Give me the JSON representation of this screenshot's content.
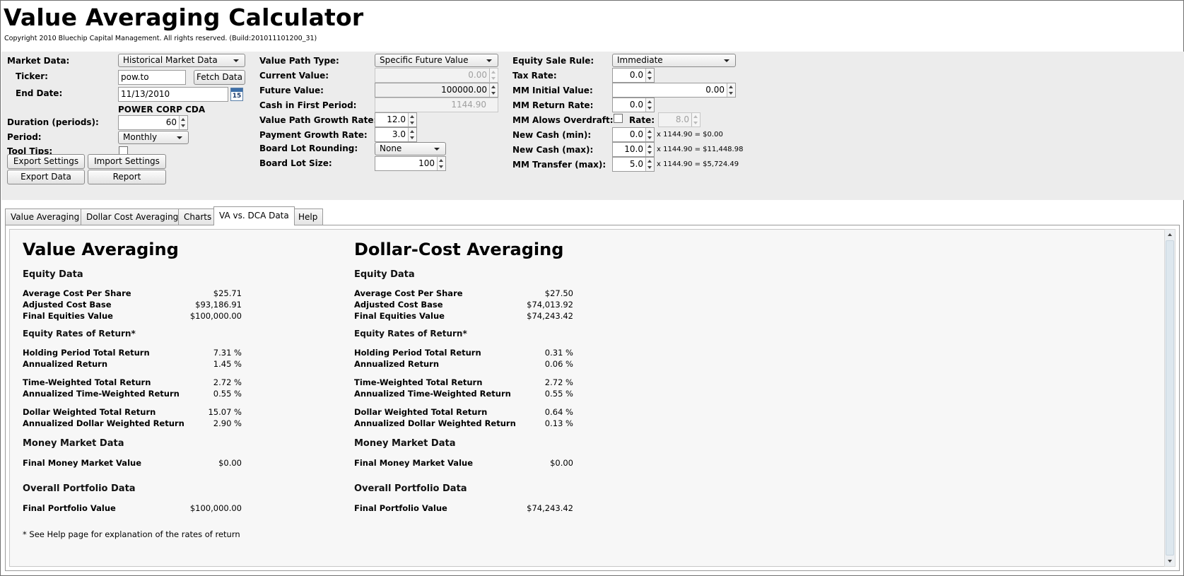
{
  "app": {
    "title": "Value Averaging Calculator",
    "copyright": "Copyright 2010 Bluechip Capital Management. All rights reserved. (Build:201011101200_31)"
  },
  "settings": {
    "market_data": {
      "label": "Market Data:",
      "value": "Historical Market Data"
    },
    "ticker": {
      "label": "Ticker:",
      "value": "pow.to"
    },
    "fetch_button": "Fetch Data",
    "end_date": {
      "label": "End Date:",
      "value": "11/13/2010",
      "calendar_day": "15"
    },
    "company_name": "POWER CORP CDA",
    "duration": {
      "label": "Duration (periods):",
      "value": "60"
    },
    "period": {
      "label": "Period:",
      "value": "Monthly"
    },
    "tool_tips": {
      "label": "Tool Tips:",
      "checked": false
    },
    "buttons": {
      "export_settings": "Export Settings",
      "import_settings": "Import Settings",
      "export_data": "Export Data",
      "report": "Report"
    },
    "value_path_type": {
      "label": "Value Path Type:",
      "value": "Specific Future Value"
    },
    "current_value": {
      "label": "Current Value:",
      "value": "0.00"
    },
    "future_value": {
      "label": "Future Value:",
      "value": "100000.00"
    },
    "cash_first_period": {
      "label": "Cash in First Period:",
      "value": "1144.90"
    },
    "value_path_growth_rate": {
      "label": "Value Path Growth Rate:",
      "value": "12.0"
    },
    "payment_growth_rate": {
      "label": "Payment Growth Rate:",
      "value": "3.0"
    },
    "board_lot_rounding": {
      "label": "Board Lot Rounding:",
      "value": "None"
    },
    "board_lot_size": {
      "label": "Board Lot Size:",
      "value": "100"
    },
    "equity_sale_rule": {
      "label": "Equity Sale Rule:",
      "value": "Immediate"
    },
    "tax_rate": {
      "label": "Tax Rate:",
      "value": "0.0"
    },
    "mm_initial_value": {
      "label": "MM Initial Value:",
      "value": "0.00"
    },
    "mm_return_rate": {
      "label": "MM Return Rate:",
      "value": "0.0"
    },
    "mm_allows_overdraft": {
      "label": "MM Alows Overdraft:",
      "checked": false,
      "rate_label": "Rate:",
      "rate_value": "8.0"
    },
    "new_cash_min": {
      "label": "New Cash (min):",
      "value": "0.0",
      "formula": "x 1144.90 = $0.00"
    },
    "new_cash_max": {
      "label": "New Cash (max):",
      "value": "10.0",
      "formula": "x 1144.90 = $11,448.98"
    },
    "mm_transfer_max": {
      "label": "MM Transfer (max):",
      "value": "5.0",
      "formula": "x 1144.90 = $5,724.49"
    }
  },
  "tabs": [
    {
      "label": "Value Averaging"
    },
    {
      "label": "Dollar Cost Averaging"
    },
    {
      "label": "Charts"
    },
    {
      "label": "VA vs. DCA Data",
      "active": true
    },
    {
      "label": "Help"
    }
  ],
  "report": {
    "labels": {
      "equity_data": "Equity Data",
      "avg_cost": "Average Cost Per Share",
      "adj_cost_base": "Adjusted Cost Base",
      "final_equities": "Final Equities Value",
      "equity_rates": "Equity Rates of Return*",
      "hp_total": "Holding Period Total Return",
      "annualized": "Annualized Return",
      "tw_total": "Time-Weighted Total Return",
      "tw_annualized": "Annualized Time-Weighted Return",
      "dw_total": "Dollar Weighted Total Return",
      "dw_annualized": "Annualized Dollar Weighted Return",
      "mm_data": "Money Market Data",
      "final_mm": "Final Money Market Value",
      "portfolio_data": "Overall Portfolio Data",
      "final_portfolio": "Final Portfolio Value"
    },
    "va": {
      "title": "Value Averaging",
      "avg_cost": "$25.71",
      "adj_cost_base": "$93,186.91",
      "final_equities": "$100,000.00",
      "hp_total": "7.31 %",
      "annualized": "1.45 %",
      "tw_total": "2.72 %",
      "tw_annualized": "0.55 %",
      "dw_total": "15.07 %",
      "dw_annualized": "2.90 %",
      "final_mm": "$0.00",
      "final_portfolio": "$100,000.00"
    },
    "dca": {
      "title": "Dollar-Cost Averaging",
      "avg_cost": "$27.50",
      "adj_cost_base": "$74,013.92",
      "final_equities": "$74,243.42",
      "hp_total": "0.31 %",
      "annualized": "0.06 %",
      "tw_total": "2.72 %",
      "tw_annualized": "0.55 %",
      "dw_total": "0.64 %",
      "dw_annualized": "0.13 %",
      "final_mm": "$0.00",
      "final_portfolio": "$74,243.42"
    },
    "footnote": "* See Help page for explanation of the rates of return"
  }
}
